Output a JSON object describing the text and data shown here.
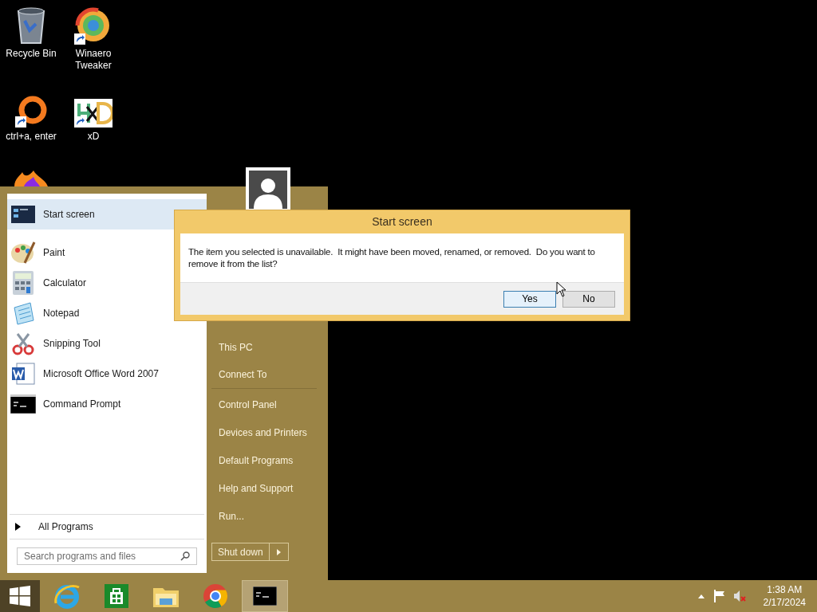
{
  "desktop_icons": [
    {
      "label": "Recycle Bin",
      "shortcut": false
    },
    {
      "label": "Winaero\nTweaker",
      "shortcut": true
    },
    {
      "label": "ctrl+a, enter",
      "shortcut": true
    },
    {
      "label": "xD",
      "shortcut": true
    }
  ],
  "start_menu": {
    "programs": [
      {
        "label": "Start screen",
        "selected": true
      },
      {
        "label": "Paint",
        "selected": false
      },
      {
        "label": "Calculator",
        "selected": false
      },
      {
        "label": "Notepad",
        "selected": false
      },
      {
        "label": "Snipping Tool",
        "selected": false
      },
      {
        "label": "Microsoft Office Word 2007",
        "selected": false
      },
      {
        "label": "Command Prompt",
        "selected": false
      }
    ],
    "all_programs": "All Programs",
    "search": {
      "placeholder": "Search programs and files"
    },
    "places": [
      {
        "label": "This PC",
        "separator_after": false
      },
      {
        "label": "Connect To",
        "separator_after": true
      },
      {
        "label": "Control Panel",
        "separator_after": false
      },
      {
        "label": "Devices and Printers",
        "separator_after": false
      },
      {
        "label": "Default Programs",
        "separator_after": false
      },
      {
        "label": "Help and Support",
        "separator_after": false
      },
      {
        "label": "Run...",
        "separator_after": false
      }
    ],
    "shutdown": "Shut down"
  },
  "dialog": {
    "title": "Start screen",
    "message": "The item you selected is unavailable.  It might have been moved, renamed, or removed.  Do you want to remove it from the list?",
    "buttons": [
      {
        "label": "Yes",
        "selected": true
      },
      {
        "label": "No",
        "selected": false
      }
    ]
  },
  "taskbar": {
    "start_selected": true,
    "pins": [
      {
        "selected": false
      },
      {
        "selected": false
      },
      {
        "selected": false
      },
      {
        "selected": false
      },
      {
        "selected": true
      }
    ],
    "clock": {
      "time": "1:38 AM",
      "date": "2/17/2024"
    }
  }
}
